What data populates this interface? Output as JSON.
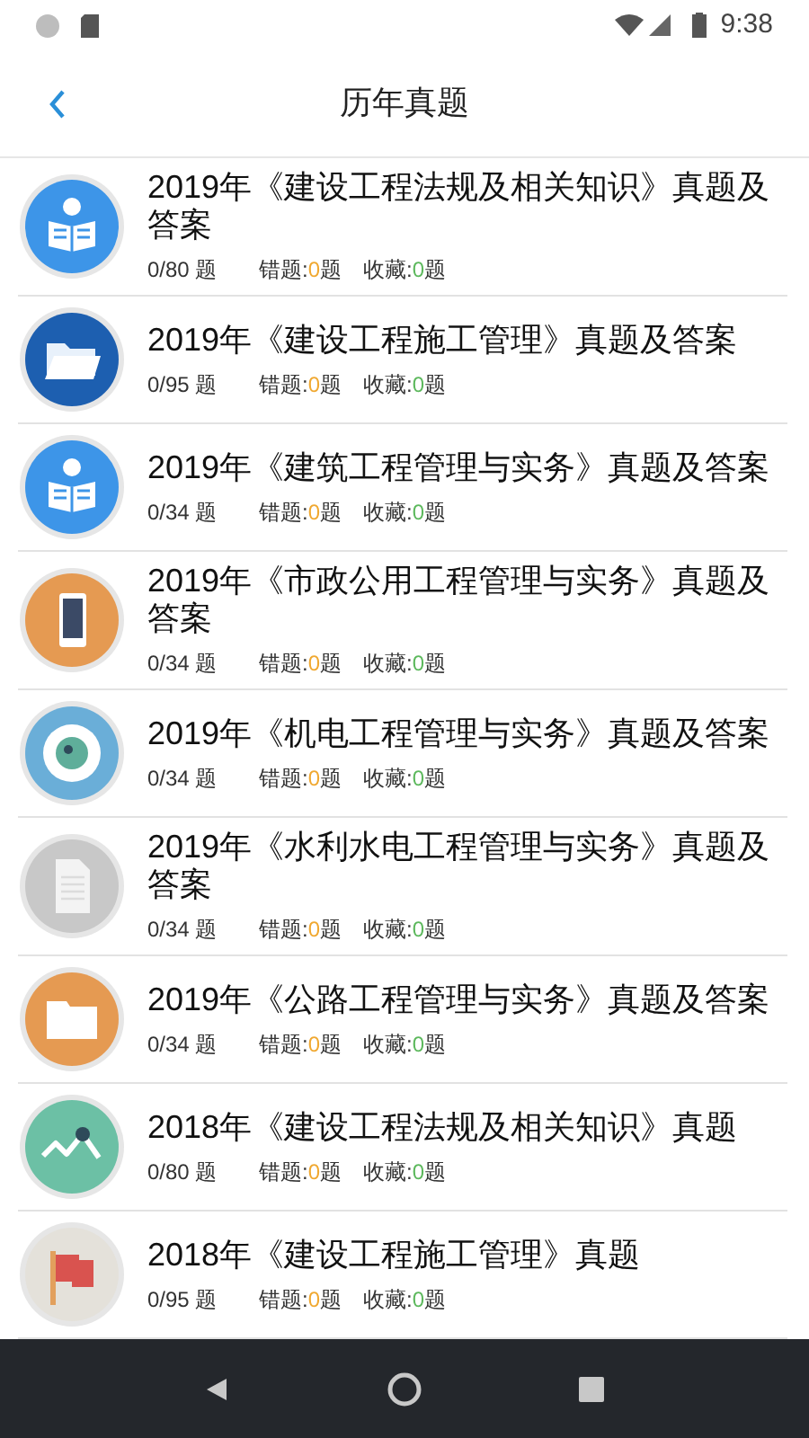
{
  "status_bar": {
    "time": "9:38"
  },
  "header": {
    "title": "历年真题"
  },
  "items": [
    {
      "title": "2019年《建设工程法规及相关知识》真题及答案",
      "kind": "reader",
      "color": "#3d95e8",
      "progress": "0/80 题",
      "wrong": {
        "label": "错题:",
        "count": "0",
        "unit": "题"
      },
      "favorites": {
        "label": "收藏:",
        "count": "0",
        "unit": "题"
      }
    },
    {
      "title": "2019年《建设工程施工管理》真题及答案",
      "kind": "folder",
      "color": "#1d5fb0",
      "progress": "0/95 题",
      "wrong": {
        "label": "错题:",
        "count": "0",
        "unit": "题"
      },
      "favorites": {
        "label": "收藏:",
        "count": "0",
        "unit": "题"
      }
    },
    {
      "title": "2019年《建筑工程管理与实务》真题及答案",
      "kind": "reader",
      "color": "#3d95e8",
      "progress": "0/34 题",
      "wrong": {
        "label": "错题:",
        "count": "0",
        "unit": "题"
      },
      "favorites": {
        "label": "收藏:",
        "count": "0",
        "unit": "题"
      }
    },
    {
      "title": "2019年《市政公用工程管理与实务》真题及答案",
      "kind": "phone",
      "color": "#e59a52",
      "progress": "0/34 题",
      "wrong": {
        "label": "错题:",
        "count": "0",
        "unit": "题"
      },
      "favorites": {
        "label": "收藏:",
        "count": "0",
        "unit": "题"
      }
    },
    {
      "title": "2019年《机电工程管理与实务》真题及答案",
      "kind": "eye",
      "color": "#6aaed8",
      "progress": "0/34 题",
      "wrong": {
        "label": "错题:",
        "count": "0",
        "unit": "题"
      },
      "favorites": {
        "label": "收藏:",
        "count": "0",
        "unit": "题"
      }
    },
    {
      "title": "2019年《水利水电工程管理与实务》真题及答案",
      "kind": "document",
      "color": "#c8c8c8",
      "progress": "0/34 题",
      "wrong": {
        "label": "错题:",
        "count": "0",
        "unit": "题"
      },
      "favorites": {
        "label": "收藏:",
        "count": "0",
        "unit": "题"
      }
    },
    {
      "title": "2019年《公路工程管理与实务》真题及答案",
      "kind": "folder-flat",
      "color": "#e59a52",
      "progress": "0/34 题",
      "wrong": {
        "label": "错题:",
        "count": "0",
        "unit": "题"
      },
      "favorites": {
        "label": "收藏:",
        "count": "0",
        "unit": "题"
      }
    },
    {
      "title": "2018年《建设工程法规及相关知识》真题",
      "kind": "chart",
      "color": "#6cc0a5",
      "progress": "0/80 题",
      "wrong": {
        "label": "错题:",
        "count": "0",
        "unit": "题"
      },
      "favorites": {
        "label": "收藏:",
        "count": "0",
        "unit": "题"
      }
    },
    {
      "title": "2018年《建设工程施工管理》真题",
      "kind": "flag",
      "color": "#e4e1da",
      "progress": "0/95 题",
      "wrong": {
        "label": "错题:",
        "count": "0",
        "unit": "题"
      },
      "favorites": {
        "label": "收藏:",
        "count": "0",
        "unit": "题"
      }
    }
  ]
}
